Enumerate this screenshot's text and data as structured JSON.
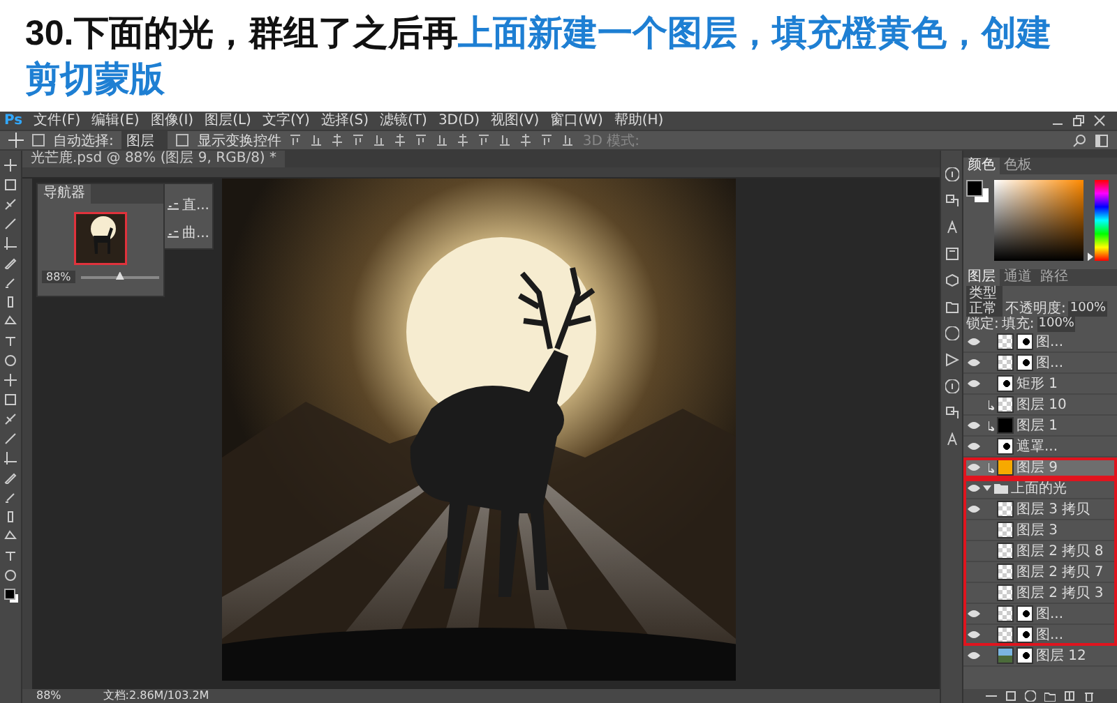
{
  "title": {
    "plain": "30.下面的光，群组了之后再",
    "highlight": "上面新建一个图层，填充橙黄色，创建剪切蒙版"
  },
  "app_logo": "Ps",
  "menu": [
    "文件(F)",
    "编辑(E)",
    "图像(I)",
    "图层(L)",
    "文字(Y)",
    "选择(S)",
    "滤镜(T)",
    "3D(D)",
    "视图(V)",
    "窗口(W)",
    "帮助(H)"
  ],
  "options": {
    "auto_select_label": "自动选择:",
    "auto_select_checked": false,
    "target": "图层",
    "show_transform_label": "显示变换控件",
    "show_transform_checked": false,
    "mode_3d_label": "3D 模式:"
  },
  "document_tab": "光芒鹿.psd @ 88% (图层 9, RGB/8) *",
  "navigator": {
    "tab": "导航器",
    "zoom": "88%",
    "level": 0.5
  },
  "adjustments": [
    "直...",
    "曲..."
  ],
  "status_bar": {
    "zoom": "88%",
    "doc_size": "文档:2.86M/103.2M"
  },
  "color_panel": {
    "tabs": [
      {
        "label": "颜色",
        "selected": true
      },
      {
        "label": "色板",
        "selected": false
      }
    ],
    "hue": {
      "level": 0.05
    }
  },
  "layers_panel": {
    "tabs": [
      {
        "label": "图层",
        "selected": true
      },
      {
        "label": "通道",
        "selected": false
      },
      {
        "label": "路径",
        "selected": false
      }
    ],
    "kind_filter": "类型",
    "blend_mode": "正常",
    "opacity_label": "不透明度:",
    "opacity": "100%",
    "lock_label": "锁定:",
    "fill_label": "填充:",
    "fill": "100%",
    "layers": [
      {
        "kind": "pixel",
        "name": "图...",
        "visible": true,
        "mask": true,
        "clipped": false,
        "selected": false,
        "highlighted": false
      },
      {
        "kind": "pixel",
        "name": "图...",
        "visible": true,
        "mask": true,
        "clipped": false,
        "selected": false,
        "highlighted": false
      },
      {
        "kind": "shape",
        "name": "矩形 1",
        "visible": true,
        "mask": false,
        "clipped": false,
        "selected": false,
        "highlighted": false
      },
      {
        "kind": "pixel",
        "name": "图层 10",
        "visible": false,
        "mask": false,
        "clipped": true,
        "selected": false,
        "highlighted": false
      },
      {
        "kind": "fill",
        "color": "#000000",
        "name": "图层 1",
        "visible": true,
        "mask": false,
        "clipped": true,
        "selected": false,
        "highlighted": false
      },
      {
        "kind": "shape",
        "name": "遮罩...",
        "visible": true,
        "mask": false,
        "clipped": false,
        "selected": false,
        "highlighted": false
      },
      {
        "kind": "fill",
        "color": "#f7a900",
        "name": "图层 9",
        "visible": true,
        "mask": false,
        "clipped": true,
        "selected": true,
        "highlighted": true
      },
      {
        "kind": "group",
        "name": "上面的光",
        "visible": true,
        "expanded": true,
        "highlighted": true,
        "children": [
          {
            "kind": "pixel",
            "name": "图层 3 拷贝",
            "visible": true,
            "mask": false,
            "clipped": false,
            "selected": false,
            "highlighted": false
          },
          {
            "kind": "pixel",
            "name": "图层 3",
            "visible": false,
            "mask": false,
            "clipped": false,
            "selected": false,
            "highlighted": false
          },
          {
            "kind": "pixel",
            "name": "图层 2 拷贝 8",
            "visible": false,
            "mask": false,
            "clipped": false,
            "selected": false,
            "highlighted": false
          },
          {
            "kind": "pixel",
            "name": "图层 2 拷贝 7",
            "visible": false,
            "mask": false,
            "clipped": false,
            "selected": false,
            "highlighted": false
          },
          {
            "kind": "pixel",
            "name": "图层 2 拷贝 3",
            "visible": false,
            "mask": false,
            "clipped": false,
            "selected": false,
            "highlighted": false
          },
          {
            "kind": "pixel",
            "name": "图...",
            "visible": true,
            "mask": true,
            "clipped": false,
            "selected": false,
            "highlighted": false
          },
          {
            "kind": "pixel",
            "name": "图...",
            "visible": true,
            "mask": true,
            "clipped": false,
            "selected": false,
            "highlighted": false
          }
        ]
      },
      {
        "kind": "image",
        "name": "图层 12",
        "visible": true,
        "mask": true,
        "clipped": false,
        "selected": false,
        "highlighted": false
      }
    ]
  }
}
